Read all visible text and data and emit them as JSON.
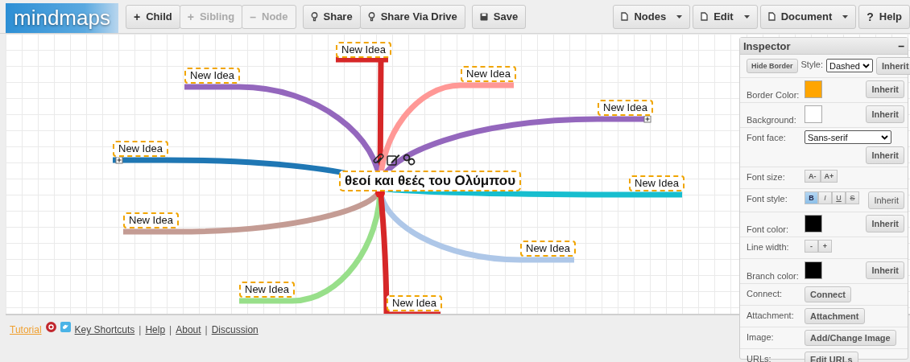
{
  "logo": "mindmaps",
  "toolbar": {
    "groups": [
      [
        {
          "glyph": "+",
          "label": "Child",
          "disabled": false
        },
        {
          "glyph": "+",
          "label": "Sibling",
          "disabled": true
        },
        {
          "glyph": "–",
          "label": "Node",
          "disabled": true
        }
      ],
      [
        {
          "kind": "pin",
          "label": "Share",
          "disabled": false
        },
        {
          "kind": "pin",
          "label": "Share Via Drive",
          "disabled": false
        }
      ],
      [
        {
          "kind": "save",
          "label": "Save",
          "disabled": false
        }
      ]
    ],
    "menus": [
      {
        "kind": "doc",
        "label": "Nodes",
        "dropdown": true
      },
      {
        "kind": "doc",
        "label": "Edit",
        "dropdown": true
      },
      {
        "kind": "doc",
        "label": "Document",
        "dropdown": true
      },
      {
        "glyph": "?",
        "label": "Help",
        "dropdown": false
      }
    ]
  },
  "mindmap": {
    "root": "θεοί και θεές του Ολύμπου",
    "branches": [
      {
        "text": "New Idea",
        "color": "#d62728",
        "collapsed": false
      },
      {
        "text": "New Idea",
        "color": "#9467bd",
        "collapsed": false
      },
      {
        "text": "New Idea",
        "color": "#ff9896",
        "collapsed": false
      },
      {
        "text": "New Idea",
        "color": "#9467bd",
        "collapsed": true
      },
      {
        "text": "New Idea",
        "color": "#1f77b4",
        "collapsed": true
      },
      {
        "text": "New Idea",
        "color": "#17becf",
        "collapsed": false
      },
      {
        "text": "New Idea",
        "color": "#c49c94",
        "collapsed": false
      },
      {
        "text": "New Idea",
        "color": "#aec7e8",
        "collapsed": false
      },
      {
        "text": "New Idea",
        "color": "#98df8a",
        "collapsed": false
      },
      {
        "text": "New Idea",
        "color": "#d62728",
        "collapsed": false
      }
    ]
  },
  "inspector": {
    "title": "Inspector",
    "minimize": "–",
    "rows": [
      {
        "kind": "border",
        "button": "Hide Border",
        "label": "Style:",
        "value": "Dashed",
        "inherit": "Inherit"
      },
      {
        "kind": "color",
        "label": "Border Color:",
        "color": "#ffa500",
        "inherit": "Inherit"
      },
      {
        "kind": "color",
        "label": "Background:",
        "color": "#ffffff",
        "inherit": "Inherit"
      },
      {
        "kind": "select",
        "label": "Font face:",
        "value": "Sans-serif",
        "inherit": "Inherit"
      },
      {
        "kind": "steps",
        "label": "Font size:",
        "buttons": [
          "A-",
          "A+"
        ]
      },
      {
        "kind": "styles",
        "label": "Font style:",
        "buttons": [
          {
            "label": "B",
            "kind": "bold",
            "selected": true
          },
          {
            "label": "I",
            "kind": "italic",
            "selected": false
          },
          {
            "label": "U",
            "kind": "underline",
            "selected": false
          },
          {
            "label": "S",
            "kind": "strike",
            "selected": false
          }
        ],
        "inherit": "Inherit"
      },
      {
        "kind": "color",
        "label": "Font color:",
        "color": "#000000",
        "inherit": "Inherit"
      },
      {
        "kind": "steps",
        "label": "Line width:",
        "buttons": [
          "-",
          "+"
        ]
      },
      {
        "kind": "color",
        "label": "Branch color:",
        "color": "#000000",
        "inherit": "Inherit"
      },
      {
        "kind": "action",
        "label": "Connect:",
        "button": "Connect"
      },
      {
        "kind": "action",
        "label": "Attachment:",
        "button": "Attachment"
      },
      {
        "kind": "action",
        "label": "Image:",
        "button": "Add/Change Image"
      },
      {
        "kind": "action",
        "label": "URLs:",
        "button": "Edit URLs"
      }
    ]
  },
  "footer": {
    "items": [
      {
        "kind": "tutorial",
        "text": "Tutorial"
      },
      {
        "kind": "gplus"
      },
      {
        "kind": "twitter"
      },
      {
        "kind": "link",
        "text": "Key Shortcuts"
      },
      {
        "kind": "sep",
        "text": "|"
      },
      {
        "kind": "link",
        "text": "Help"
      },
      {
        "kind": "sep",
        "text": "|"
      },
      {
        "kind": "link",
        "text": "About"
      },
      {
        "kind": "sep",
        "text": "|"
      },
      {
        "kind": "link",
        "text": "Discussion"
      }
    ]
  }
}
